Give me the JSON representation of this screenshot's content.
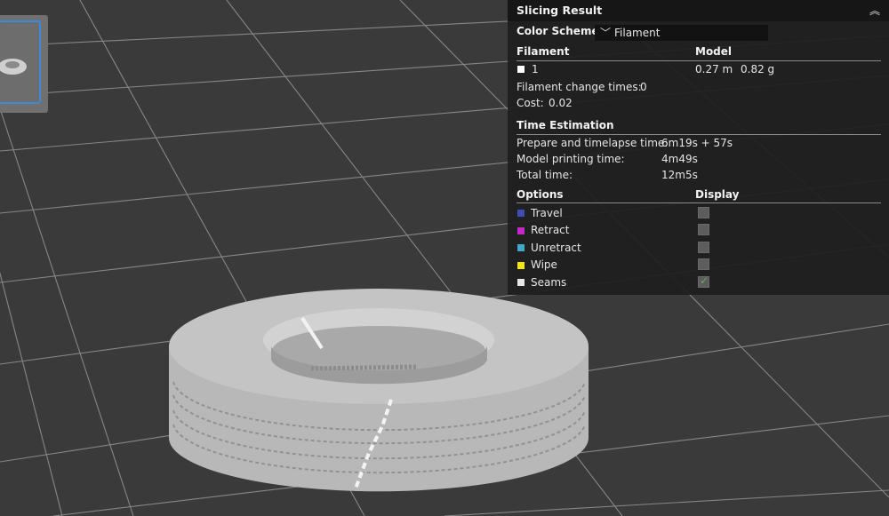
{
  "panel": {
    "title": "Slicing Result",
    "color_scheme": {
      "label": "Color Scheme",
      "value": "Filament"
    },
    "filament_header": "Filament",
    "model_header": "Model",
    "filament": {
      "id": "1",
      "color": "#ffffff",
      "length": "0.27 m",
      "weight": "0.82 g"
    },
    "change_times": {
      "label": "Filament change times:",
      "value": "0"
    },
    "cost": {
      "label": "Cost:",
      "value": "0.02"
    },
    "time_header": "Time Estimation",
    "times": [
      {
        "label": "Prepare and timelapse time:",
        "value": "6m19s + 57s"
      },
      {
        "label": "Model printing time:",
        "value": "4m49s"
      },
      {
        "label": "Total time:",
        "value": "12m5s"
      }
    ],
    "options_header": "Options",
    "display_header": "Display",
    "options": [
      {
        "label": "Travel",
        "color": "#3e4fb4",
        "checked": false
      },
      {
        "label": "Retract",
        "color": "#c02cc4",
        "checked": false
      },
      {
        "label": "Unretract",
        "color": "#40a8c8",
        "checked": false
      },
      {
        "label": "Wipe",
        "color": "#f2e616",
        "checked": false
      },
      {
        "label": "Seams",
        "color": "#e6e6e6",
        "checked": true
      }
    ]
  },
  "viewport": {
    "background": "#3a3a3a",
    "grid_color": "#8e8e8e",
    "model_color": "#c8c8c8"
  }
}
